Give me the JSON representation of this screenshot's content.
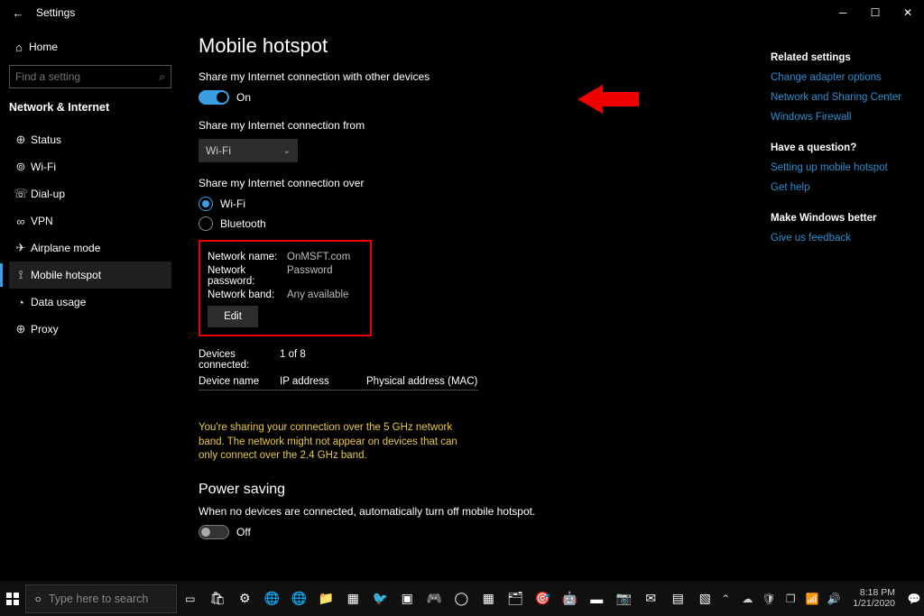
{
  "titlebar": {
    "back": "←",
    "title": "Settings"
  },
  "sidebar": {
    "home": "Home",
    "search_placeholder": "Find a setting",
    "category": "Network & Internet",
    "items": [
      {
        "icon": "status-icon",
        "label": "Status"
      },
      {
        "icon": "wifi-icon",
        "label": "Wi-Fi"
      },
      {
        "icon": "dialup-icon",
        "label": "Dial-up"
      },
      {
        "icon": "vpn-icon",
        "label": "VPN"
      },
      {
        "icon": "airplane-icon",
        "label": "Airplane mode"
      },
      {
        "icon": "hotspot-icon",
        "label": "Mobile hotspot"
      },
      {
        "icon": "datausage-icon",
        "label": "Data usage"
      },
      {
        "icon": "proxy-icon",
        "label": "Proxy"
      }
    ],
    "selected_index": 5
  },
  "content": {
    "title": "Mobile hotspot",
    "share_label": "Share my Internet connection with other devices",
    "share_toggle_state": "On",
    "from_label": "Share my Internet connection from",
    "from_dropdown_value": "Wi-Fi",
    "over_label": "Share my Internet connection over",
    "over_options": [
      "Wi-Fi",
      "Bluetooth"
    ],
    "over_selected": 0,
    "network": {
      "name_label": "Network name:",
      "name_value": "OnMSFT.com",
      "password_label": "Network password:",
      "password_value": "Password",
      "band_label": "Network band:",
      "band_value": "Any available",
      "edit": "Edit"
    },
    "devices_connected_label": "Devices connected:",
    "devices_connected_value": "1 of 8",
    "device_table_headers": [
      "Device name",
      "IP address",
      "Physical address (MAC)"
    ],
    "warning": "You're sharing your connection over the 5 GHz network band. The network might not appear on devices that can only connect over the 2.4 GHz band.",
    "power_saving_title": "Power saving",
    "power_saving_label": "When no devices are connected, automatically turn off mobile hotspot.",
    "power_saving_state": "Off"
  },
  "right": {
    "related_title": "Related settings",
    "links1": [
      "Change adapter options",
      "Network and Sharing Center",
      "Windows Firewall"
    ],
    "question_title": "Have a question?",
    "links2": [
      "Setting up mobile hotspot",
      "Get help"
    ],
    "better_title": "Make Windows better",
    "links3": [
      "Give us feedback"
    ]
  },
  "taskbar": {
    "search_placeholder": "Type here to search",
    "time": "8:18 PM",
    "date": "1/21/2020"
  }
}
